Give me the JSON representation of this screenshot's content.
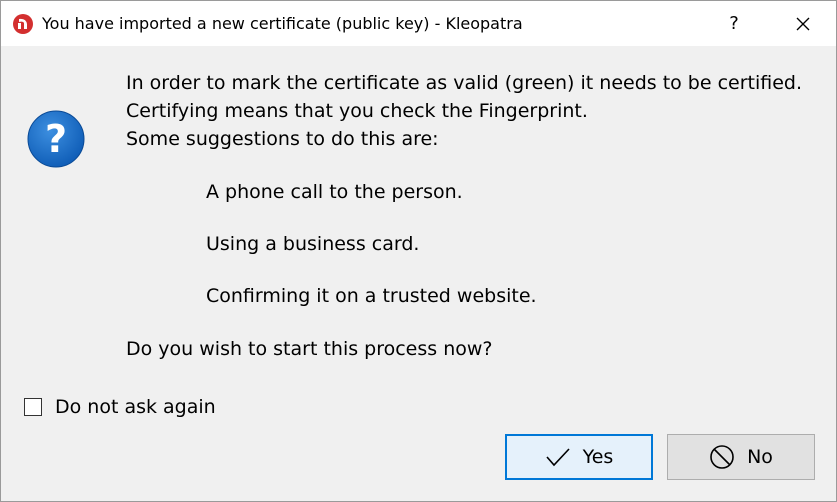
{
  "window": {
    "title": "You have imported a new certificate (public key) - Kleopatra",
    "help_label": "?",
    "app_icon": "kleopatra-icon",
    "close_icon": "close-icon"
  },
  "message": {
    "icon": "question-icon",
    "icon_glyph": "?",
    "lines": [
      "In order to mark the certificate as valid (green) it needs to be certified.",
      "Certifying means that you check the Fingerprint.",
      "Some suggestions to do this are:"
    ],
    "suggestions": [
      "A phone call to the person.",
      "Using a business card.",
      "Confirming it on a trusted website."
    ],
    "prompt": "Do you wish to start this process now?"
  },
  "checkbox": {
    "label": "Do not ask again",
    "checked": false
  },
  "buttons": {
    "yes": {
      "label": "Yes",
      "icon": "checkmark-icon"
    },
    "no": {
      "label": "No",
      "icon": "no-entry-icon"
    }
  },
  "colors": {
    "accent": "#0078d7",
    "question_icon": "#1565c0",
    "app_icon": "#d32f2f"
  }
}
